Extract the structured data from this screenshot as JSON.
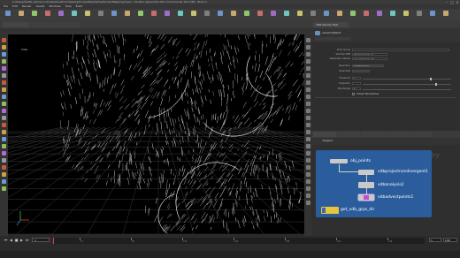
{
  "window": {
    "title": "C:/Users/dsaltz_demos_tutorials/houdini/mapping/ScreenMap/Setup/ScreenMapping/input - Houdini Apprentice Non-Commercial 18.0.460 - Build 1"
  },
  "menubar": [
    "File",
    "Edit",
    "Render",
    "Assets",
    "Windows",
    "Help",
    "Build"
  ],
  "viewport": {
    "label": "View"
  },
  "parameters": {
    "node_label": "VDB Velocity Field",
    "node_name": "volvelocityfield1",
    "rows": [
      {
        "label": "Point Group",
        "value": ""
      },
      {
        "label": "Velocity VDB",
        "value": "@name=gmnt_vel"
      },
      {
        "label": "Destination Name",
        "value": "vel_name=vel_out"
      },
      {
        "label": "Operation",
        "value": "Unit/Normalize"
      },
      {
        "label": "Voxel Size",
        "value": ""
      },
      {
        "label": "Threshold",
        "value": "1"
      },
      {
        "label": "Projection",
        "value": ""
      },
      {
        "label": "Max Range",
        "value": "0"
      }
    ],
    "checkbox_label": "Output Streamlines"
  },
  "network": {
    "path_label": "/obj/geo1",
    "nodes": [
      {
        "name": "obj_points"
      },
      {
        "name": "vdbprojectnondivergent1"
      },
      {
        "name": "vdbanalysis2"
      },
      {
        "name": "vdbadvectpoints1"
      },
      {
        "name": "get_vdb_grps_dir"
      }
    ],
    "watermark": "Geometry"
  },
  "timeline": {
    "ticks": [
      "72",
      "96",
      "120",
      "144",
      "168",
      "192",
      "216"
    ],
    "start_frame": "1",
    "end_frame": "240",
    "current_frame": "1"
  },
  "colors": {
    "network_box": "#2b5d9c",
    "viewport_bg": "#000000",
    "node_yellow": "#e8c53a"
  }
}
